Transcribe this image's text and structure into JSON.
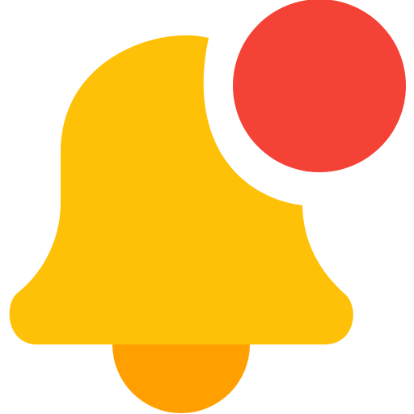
{
  "icon": {
    "name": "notification-bell-icon",
    "colors": {
      "bell_body": "#FFC107",
      "bell_clapper": "#FFA000",
      "notification_dot": "#F44336",
      "background": "#FFFFFF"
    },
    "has_unread_notification": true
  }
}
